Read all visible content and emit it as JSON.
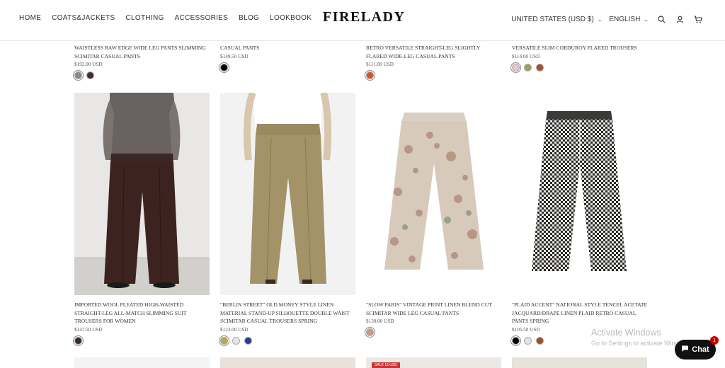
{
  "header": {
    "nav": [
      "HOME",
      "COATS&JACKETS",
      "CLOTHING",
      "ACCESSORIES",
      "BLOG",
      "LOOKBOOK"
    ],
    "logo": "FIRELADY",
    "currency": "UNITED STATES (USD $)",
    "language": "ENGLISH"
  },
  "top_row": [
    {
      "title": "WAISTLESS RAW EDGE WIDE LEG PANTS SLIMMING SCIMITAR CASUAL PANTS",
      "price": "$192.00 USD",
      "swatches": [
        "#8a8a8a",
        "#4a2a2a"
      ]
    },
    {
      "title": "CASUAL PANTS",
      "price": "$149.50 USD",
      "swatches": [
        "#000000"
      ]
    },
    {
      "title": "RETRO VERSATILE STRAIGHT-LEG SLIGHTLY FLARED WIDE-LEG CASUAL PANTS",
      "price": "$111.00 USD",
      "swatches": [
        "#d9532a"
      ]
    },
    {
      "title": "VERSATILE SLIM CORDUROY FLARED TROUSERS",
      "price": "$114.00 USD",
      "swatches": [
        "#f0c5c8",
        "#9d9f5d",
        "#a4502a"
      ]
    }
  ],
  "products": [
    {
      "title": "IMPORTED WOOL PLEATED HIGH-WAISTED STRAIGHT-LEG ALL-MATCH SLIMMING SUIT TROUSERS FOR WOMEN",
      "price": "$147.50 USD",
      "swatches": [
        "#3c2a26"
      ]
    },
    {
      "title": "\"BERLIN STREET\" OLD MONEY STYLE LINEN MATERIAL STAND-UP SILHOUETTE DOUBLE WAIST SCIMITAR CASUAL TROUSERS SPRING",
      "price": "$123.00 USD",
      "swatches": [
        "#b9a64c",
        "#e6e6e6",
        "#2b3c8f"
      ]
    },
    {
      "title": "\"SLOW PARIS\" VINTAGE PRINT LINEN BLEND CUT SCIMITAR WIDE LEG CASUAL PANTS",
      "price": "$130.00 USD",
      "swatches": [
        "#c99a83"
      ]
    },
    {
      "title": "\"PLAID ACCENT\" NATIONAL STYLE TENCEL ACETATE JACQUARD/DRAPE LINEN PLAID RETRO CASUAL PANTS SPRING",
      "price": "$105.50 USD",
      "swatches": [
        "#000000",
        "#e3e3e3",
        "#a04f28"
      ]
    }
  ],
  "sale_tag": "SALE 15 USD",
  "activate": {
    "line1": "Activate Windows",
    "line2": "Go to Settings to activate Windows."
  },
  "chat": {
    "label": "Chat",
    "badge": "1"
  }
}
